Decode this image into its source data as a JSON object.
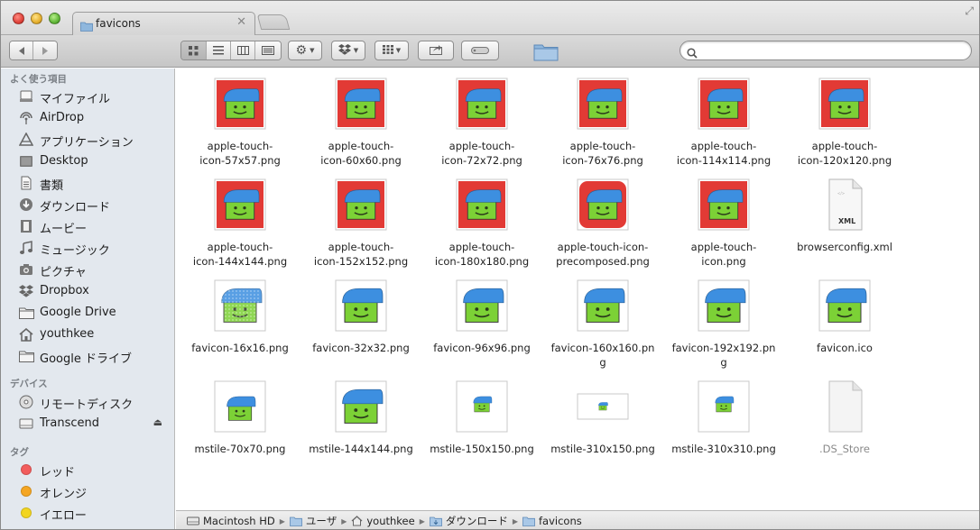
{
  "window": {
    "tab_title": "favicons"
  },
  "sidebar": {
    "favorites_header": "よく使う項目",
    "favorites": [
      {
        "label": "マイファイル",
        "icon": "all-my-files-icon"
      },
      {
        "label": "AirDrop",
        "icon": "airdrop-icon"
      },
      {
        "label": "アプリケーション",
        "icon": "applications-icon"
      },
      {
        "label": "Desktop",
        "icon": "desktop-icon"
      },
      {
        "label": "書類",
        "icon": "documents-icon"
      },
      {
        "label": "ダウンロード",
        "icon": "downloads-icon"
      },
      {
        "label": "ムービー",
        "icon": "movies-icon"
      },
      {
        "label": "ミュージック",
        "icon": "music-icon"
      },
      {
        "label": "ピクチャ",
        "icon": "pictures-icon"
      },
      {
        "label": "Dropbox",
        "icon": "dropbox-icon"
      },
      {
        "label": "Google Drive",
        "icon": "folder-icon"
      },
      {
        "label": "youthkee",
        "icon": "home-icon"
      },
      {
        "label": "Google ドライブ",
        "icon": "folder-icon"
      }
    ],
    "devices_header": "デバイス",
    "devices": [
      {
        "label": "リモートディスク",
        "icon": "remote-disc-icon"
      },
      {
        "label": "Transcend",
        "icon": "drive-icon"
      }
    ],
    "tags_header": "タグ",
    "tags": [
      {
        "label": "レッド",
        "color": "#f25c5c"
      },
      {
        "label": "オレンジ",
        "color": "#f5a623"
      },
      {
        "label": "イエロー",
        "color": "#f2d520"
      }
    ]
  },
  "files": [
    {
      "name": "apple-touch-icon-57x57.png",
      "style": "red"
    },
    {
      "name": "apple-touch-icon-60x60.png",
      "style": "red"
    },
    {
      "name": "apple-touch-icon-72x72.png",
      "style": "red"
    },
    {
      "name": "apple-touch-icon-76x76.png",
      "style": "red"
    },
    {
      "name": "apple-touch-icon-114x114.png",
      "style": "red"
    },
    {
      "name": "apple-touch-icon-120x120.png",
      "style": "red"
    },
    {
      "name": "apple-touch-icon-144x144.png",
      "style": "red"
    },
    {
      "name": "apple-touch-icon-152x152.png",
      "style": "red"
    },
    {
      "name": "apple-touch-icon-180x180.png",
      "style": "red"
    },
    {
      "name": "apple-touch-icon-precomposed.png",
      "style": "red-round"
    },
    {
      "name": "apple-touch-icon.png",
      "style": "red"
    },
    {
      "name": "browserconfig.xml",
      "style": "xml"
    },
    {
      "name": "favicon-16x16.png",
      "style": "pixel"
    },
    {
      "name": "favicon-32x32.png",
      "style": "white"
    },
    {
      "name": "favicon-96x96.png",
      "style": "white"
    },
    {
      "name": "favicon-160x160.png",
      "style": "white"
    },
    {
      "name": "favicon-192x192.png",
      "style": "white"
    },
    {
      "name": "favicon.ico",
      "style": "white"
    },
    {
      "name": "mstile-70x70.png",
      "style": "tile-md"
    },
    {
      "name": "mstile-144x144.png",
      "style": "tile-lg"
    },
    {
      "name": "mstile-150x150.png",
      "style": "tile-sm"
    },
    {
      "name": "mstile-310x150.png",
      "style": "tile-wide"
    },
    {
      "name": "mstile-310x310.png",
      "style": "tile-sm"
    },
    {
      "name": ".DS_Store",
      "style": "blank"
    }
  ],
  "file_labels": {
    "row1": [
      "apple-touch-\nicon-57x57.png",
      "apple-touch-\nicon-60x60.png",
      "apple-touch-\nicon-72x72.png",
      "apple-touch-\nicon-76x76.png",
      "apple-touch-\nicon-114x114.png",
      "apple-touch-\nicon-120x120.png"
    ]
  },
  "xml_badge": "XML",
  "pathbar": [
    {
      "label": "Macintosh HD",
      "icon": "hard-drive-icon"
    },
    {
      "label": "ユーザ",
      "icon": "folder-icon"
    },
    {
      "label": "youthkee",
      "icon": "home-icon"
    },
    {
      "label": "ダウンロード",
      "icon": "downloads-folder-icon"
    },
    {
      "label": "favicons",
      "icon": "folder-icon"
    }
  ],
  "colors": {
    "icon_red": "#e23a35",
    "cap_blue": "#3d8fe0",
    "face_green": "#7cd136",
    "folder_blue": "#8fb7dd"
  }
}
